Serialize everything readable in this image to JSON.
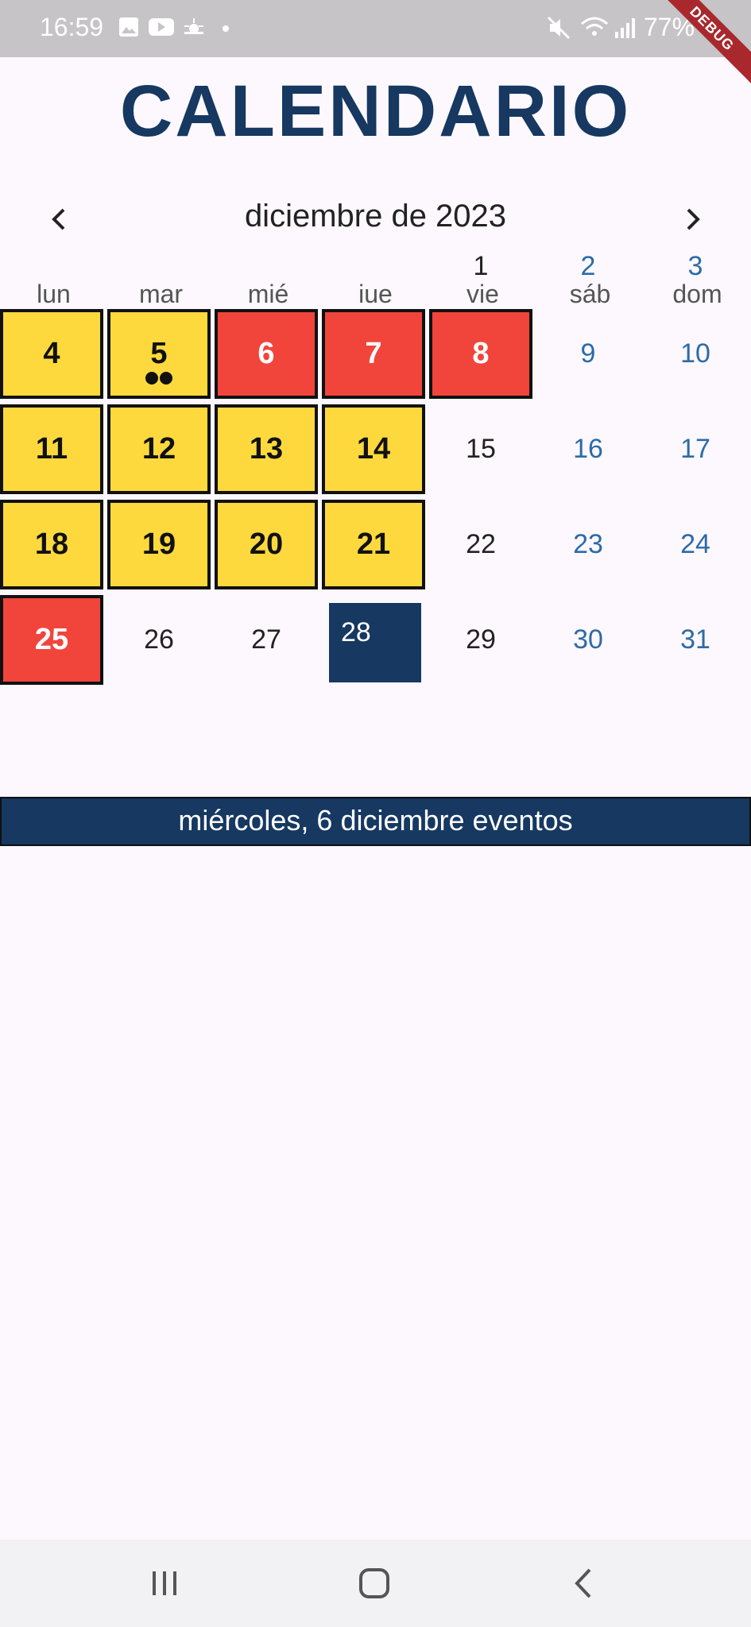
{
  "status_bar": {
    "time": "16:59",
    "battery": "77%",
    "debug_label": "DEBUG"
  },
  "title": "CALENDARIO",
  "month": {
    "label": "diciembre de 2023",
    "prev_icon": "chevron-left-icon",
    "next_icon": "chevron-right-icon"
  },
  "weekdays": [
    "lun",
    "mar",
    "mié",
    "iue",
    "vie",
    "sáb",
    "dom"
  ],
  "days": [
    {
      "day": "1",
      "col": 4,
      "row": 0,
      "style": "plain"
    },
    {
      "day": "2",
      "col": 5,
      "row": 0,
      "style": "weekend"
    },
    {
      "day": "3",
      "col": 6,
      "row": 0,
      "style": "weekend"
    },
    {
      "day": "4",
      "col": 0,
      "row": 1,
      "style": "yellow"
    },
    {
      "day": "5",
      "col": 1,
      "row": 1,
      "style": "yellow",
      "event_dots": 2
    },
    {
      "day": "6",
      "col": 2,
      "row": 1,
      "style": "red"
    },
    {
      "day": "7",
      "col": 3,
      "row": 1,
      "style": "red"
    },
    {
      "day": "8",
      "col": 4,
      "row": 1,
      "style": "red"
    },
    {
      "day": "9",
      "col": 5,
      "row": 1,
      "style": "weekend"
    },
    {
      "day": "10",
      "col": 6,
      "row": 1,
      "style": "weekend"
    },
    {
      "day": "11",
      "col": 0,
      "row": 2,
      "style": "yellow"
    },
    {
      "day": "12",
      "col": 1,
      "row": 2,
      "style": "yellow"
    },
    {
      "day": "13",
      "col": 2,
      "row": 2,
      "style": "yellow"
    },
    {
      "day": "14",
      "col": 3,
      "row": 2,
      "style": "yellow"
    },
    {
      "day": "15",
      "col": 4,
      "row": 2,
      "style": "plain"
    },
    {
      "day": "16",
      "col": 5,
      "row": 2,
      "style": "weekend"
    },
    {
      "day": "17",
      "col": 6,
      "row": 2,
      "style": "weekend"
    },
    {
      "day": "18",
      "col": 0,
      "row": 3,
      "style": "yellow"
    },
    {
      "day": "19",
      "col": 1,
      "row": 3,
      "style": "yellow"
    },
    {
      "day": "20",
      "col": 2,
      "row": 3,
      "style": "yellow"
    },
    {
      "day": "21",
      "col": 3,
      "row": 3,
      "style": "yellow"
    },
    {
      "day": "22",
      "col": 4,
      "row": 3,
      "style": "plain"
    },
    {
      "day": "23",
      "col": 5,
      "row": 3,
      "style": "weekend"
    },
    {
      "day": "24",
      "col": 6,
      "row": 3,
      "style": "weekend"
    },
    {
      "day": "25",
      "col": 0,
      "row": 4,
      "style": "red"
    },
    {
      "day": "26",
      "col": 1,
      "row": 4,
      "style": "plain"
    },
    {
      "day": "27",
      "col": 2,
      "row": 4,
      "style": "plain"
    },
    {
      "day": "28",
      "col": 3,
      "row": 4,
      "style": "today"
    },
    {
      "day": "29",
      "col": 4,
      "row": 4,
      "style": "plain"
    },
    {
      "day": "30",
      "col": 5,
      "row": 4,
      "style": "weekend"
    },
    {
      "day": "31",
      "col": 6,
      "row": 4,
      "style": "weekend"
    }
  ],
  "events_bar": "miércoles, 6 diciembre eventos",
  "colors": {
    "primary": "#163861",
    "holiday_red": "#f1453c",
    "workday_yellow": "#fed93d",
    "weekend_blue": "#2c6ba8"
  },
  "nav_bar": {
    "recents_icon": "recents-icon",
    "home_icon": "home-icon",
    "back_icon": "back-icon"
  }
}
